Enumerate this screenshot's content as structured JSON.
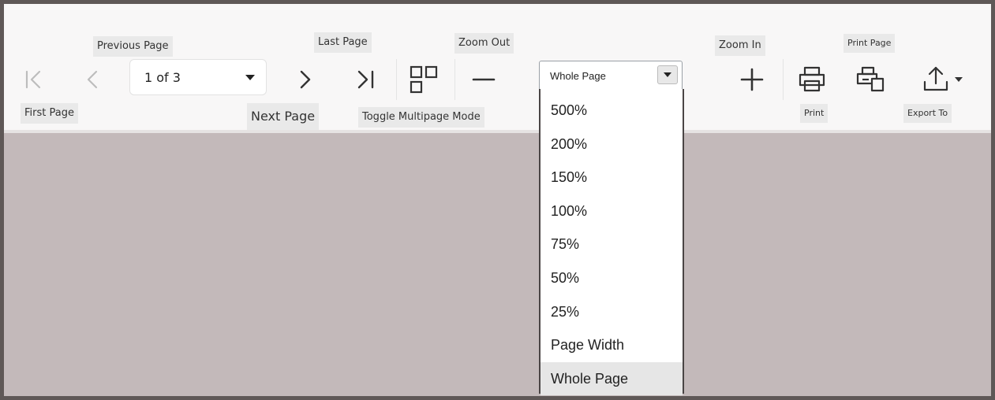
{
  "toolbar": {
    "page_indicator": "1 of 3",
    "tooltips": {
      "previous_page": "Previous Page",
      "last_page": "Last Page",
      "zoom_out": "Zoom Out",
      "zoom_in": "Zoom In",
      "print_page": "Print Page",
      "first_page": "First Page",
      "next_page": "Next Page",
      "toggle_multipage": "Toggle Multipage Mode",
      "print": "Print",
      "export_to": "Export To"
    },
    "icons": {
      "first": "first-page-icon",
      "previous": "previous-page-icon",
      "next": "next-page-icon",
      "last": "last-page-icon",
      "multipage": "multipage-icon",
      "zoom_out": "minus-icon",
      "zoom_in": "plus-icon",
      "print": "printer-icon",
      "print_page": "print-page-icon",
      "export": "upload-icon"
    }
  },
  "zoom": {
    "selected": "Whole Page",
    "options": [
      "500%",
      "200%",
      "150%",
      "100%",
      "75%",
      "50%",
      "25%",
      "Page Width",
      "Whole Page"
    ]
  },
  "colors": {
    "frame": "#5f5857",
    "viewer_background": "#c3b9ba",
    "toolbar_background": "#f8f7f7"
  }
}
